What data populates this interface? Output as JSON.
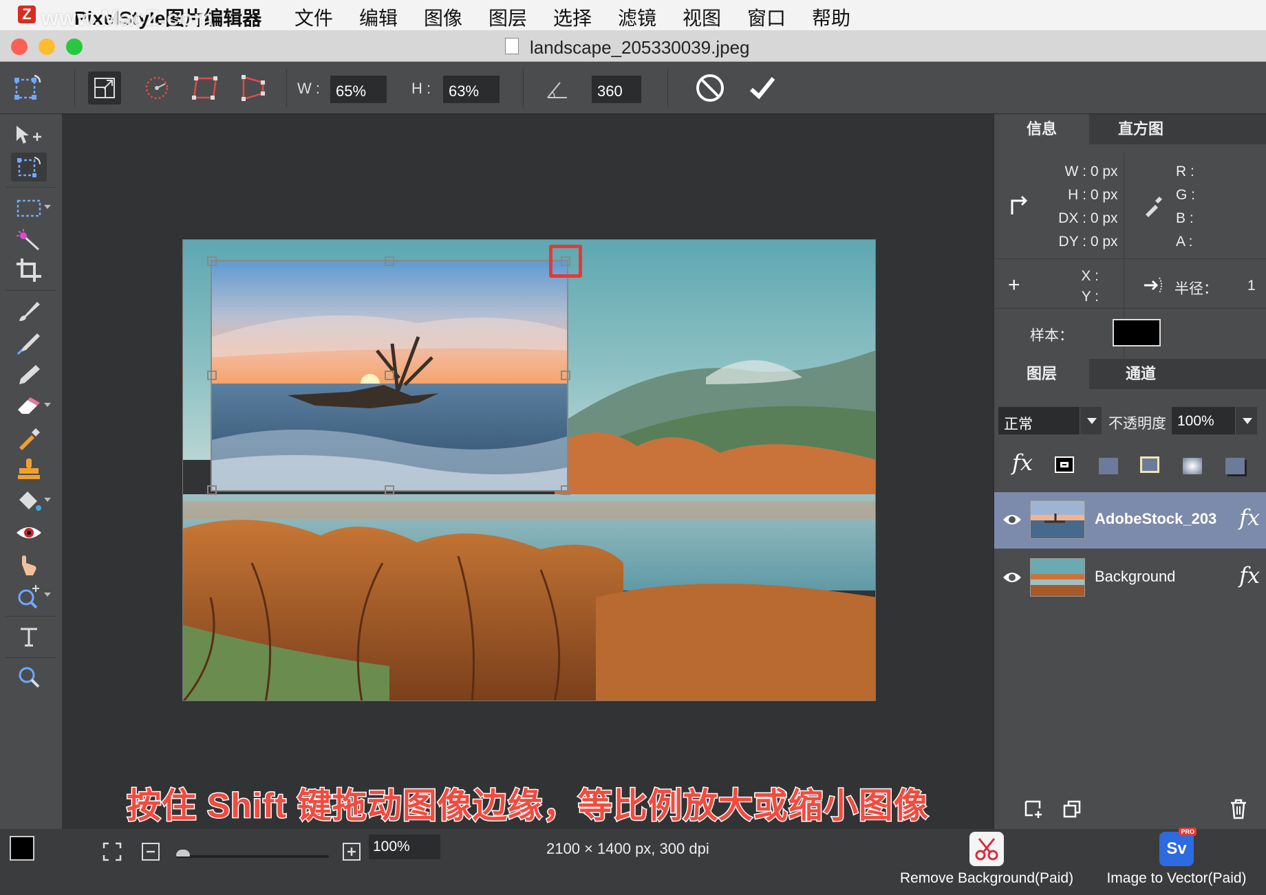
{
  "menubar": {
    "app_name": "PixelStyle图片编辑器",
    "watermark": "www.MacZ.com",
    "items": [
      "文件",
      "编辑",
      "图像",
      "图层",
      "选择",
      "滤镜",
      "视图",
      "窗口",
      "帮助"
    ]
  },
  "window": {
    "title": "landscape_205330039.jpeg"
  },
  "toolbar": {
    "width_label": "W :",
    "width_value": "65%",
    "height_label": "H :",
    "height_value": "63%",
    "angle_value": "360"
  },
  "info_panel": {
    "tabs": [
      "信息",
      "直方图"
    ],
    "w_label": "W :",
    "w_value": "0 px",
    "h_label": "H :",
    "h_value": "0 px",
    "dx_label": "DX :",
    "dx_value": "0 px",
    "dy_label": "DY :",
    "dy_value": "0 px",
    "r_label": "R :",
    "g_label": "G :",
    "b_label": "B :",
    "a_label": "A :",
    "x_label": "X :",
    "y_label": "Y :",
    "radius_label": "半径：",
    "radius_value": "1",
    "sample_label": "样本：",
    "sample_color": "#000000"
  },
  "layers_panel": {
    "tabs": [
      "图层",
      "通道"
    ],
    "blend_mode": "正常",
    "opacity_label": "不透明度",
    "opacity_value": "100%",
    "fx_label": "fx",
    "layers": [
      {
        "name": "AdobeStock_203",
        "selected": true,
        "fx": "fx"
      },
      {
        "name": "Background",
        "selected": false,
        "fx": "fx"
      }
    ]
  },
  "canvas": {
    "caption": "按住 Shift 键拖动图像边缘，等比例放大或缩小图像"
  },
  "statusbar": {
    "zoom_value": "100%",
    "dimensions": "2100 × 1400 px, 300 dpi",
    "plugins": [
      {
        "label": "Remove Background(Paid)",
        "icon": "scissors-icon"
      },
      {
        "label": "Image to Vector(Paid)",
        "icon": "sv-icon",
        "badge": "PRO",
        "icon_text": "Sv"
      }
    ]
  },
  "colors": {
    "accent_selected_layer": "#7c8bab",
    "caption_red": "#f24b3f",
    "highlight_red": "#e53935",
    "foreground": "#000000",
    "background": "#ffffff"
  }
}
